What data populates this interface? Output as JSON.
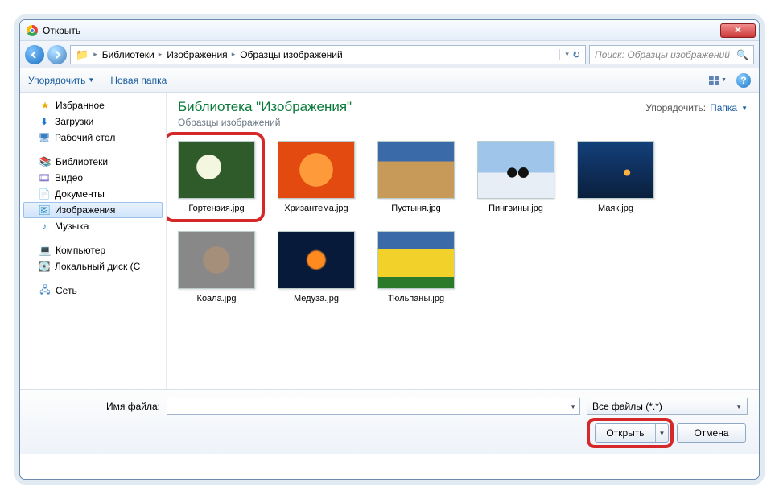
{
  "window": {
    "title": "Открыть"
  },
  "breadcrumb": [
    "Библиотеки",
    "Изображения",
    "Образцы изображений"
  ],
  "search": {
    "placeholder": "Поиск: Образцы изображений"
  },
  "toolbar": {
    "organize": "Упорядочить",
    "new_folder": "Новая папка"
  },
  "sidebar": {
    "favorites": {
      "label": "Избранное",
      "items": [
        "Загрузки",
        "Рабочий стол"
      ]
    },
    "libraries": {
      "label": "Библиотеки",
      "items": [
        "Видео",
        "Документы",
        "Изображения",
        "Музыка"
      ]
    },
    "computer": {
      "label": "Компьютер",
      "items": [
        "Локальный диск (C"
      ]
    },
    "network": {
      "label": "Сеть"
    }
  },
  "header": {
    "title": "Библиотека \"Изображения\"",
    "subtitle": "Образцы изображений",
    "sort_label": "Упорядочить:",
    "sort_value": "Папка"
  },
  "files": [
    {
      "name": "Гортензия.jpg",
      "paint": "p0"
    },
    {
      "name": "Хризантема.jpg",
      "paint": "p1"
    },
    {
      "name": "Пустыня.jpg",
      "paint": "p2"
    },
    {
      "name": "Пингвины.jpg",
      "paint": "p3"
    },
    {
      "name": "Маяк.jpg",
      "paint": "p4"
    },
    {
      "name": "Коала.jpg",
      "paint": "p5"
    },
    {
      "name": "Медуза.jpg",
      "paint": "p6"
    },
    {
      "name": "Тюльпаны.jpg",
      "paint": "p7"
    }
  ],
  "bottom": {
    "filename_label": "Имя файла:",
    "filename_value": "",
    "filter": "Все файлы (*.*)",
    "open": "Открыть",
    "cancel": "Отмена"
  }
}
